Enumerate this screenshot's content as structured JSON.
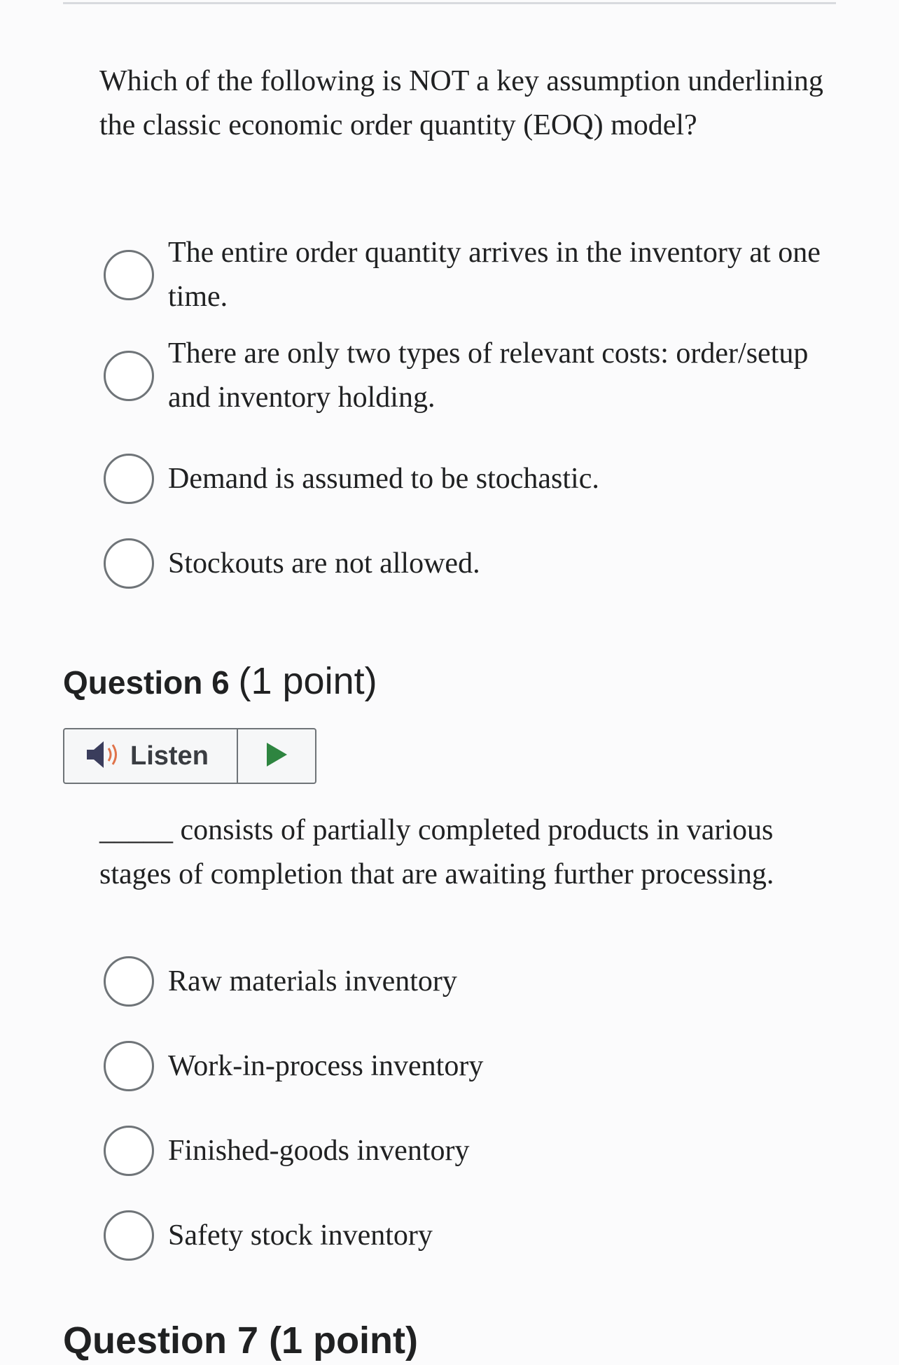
{
  "question5": {
    "text": "Which of the following is NOT a key assumption underlining the classic economic order quantity (EOQ) model?",
    "options": [
      "The entire order quantity arrives in the inventory at one time.",
      "There are only two types of relevant costs: order/setup and inventory holding.",
      "Demand is assumed to be stochastic.",
      "Stockouts are not allowed."
    ]
  },
  "question6": {
    "title": "Question 6",
    "points": "(1 point)",
    "listen_label": "Listen",
    "text": "_____ consists of partially completed products in various stages of completion that are awaiting further processing.",
    "options": [
      "Raw materials inventory",
      "Work-in-process inventory",
      "Finished-goods inventory",
      "Safety stock inventory"
    ]
  },
  "question7": {
    "title": "Question 7",
    "points": "(1 point)"
  },
  "icons": {
    "speaker": "speaker-icon",
    "play": "play-icon",
    "radio": "radio-unchecked-icon"
  },
  "colors": {
    "speaker_body": "#3a3d5c",
    "speaker_waves": "#e0734a",
    "play": "#2e8540",
    "radio_border": "#6f7478"
  }
}
